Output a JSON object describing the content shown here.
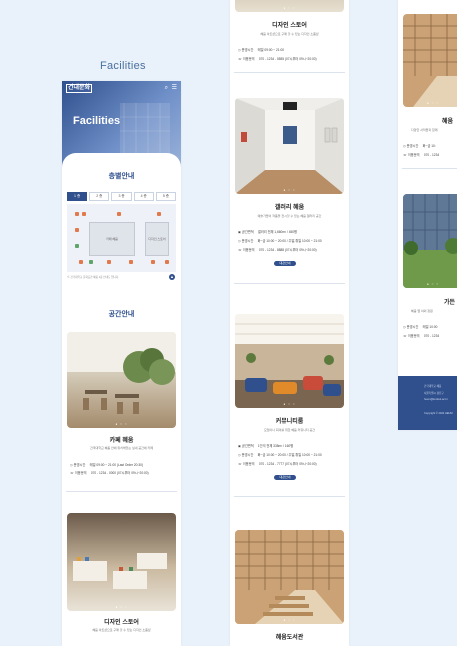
{
  "section_label": "Facilities",
  "mobile": {
    "logo": "건대문화",
    "hero_title": "Facilities",
    "floor_guide": {
      "title": "층별안내",
      "floors": [
        "1 층",
        "2 층",
        "3 층",
        "4 층",
        "5 층"
      ],
      "rooms": [
        "카페 혜움",
        "디자인 스토어"
      ],
      "note": "※ 건국대학교 문화공간 혜움 1층 안내도 입니다."
    },
    "space_guide_title": "공간안내",
    "cafe": {
      "title": "카페 혜움",
      "desc": "건국대학교 혜움 안에 위치해있는 실내 공간에 카페",
      "hours_label": "운영시간",
      "hours": "매일 09:00 ~ 21:00 (Last Order 20:30)",
      "phone_label": "이용문의",
      "phone": "070 - 1234 - 0000 (07시부터 09시~20:00)"
    },
    "store_left": {
      "title": "디자인 스토어",
      "desc": "혜움 아트샵으로 구매 할 수 있는 디자인 소품샵"
    }
  },
  "column2": {
    "store": {
      "title": "디자인 스토어",
      "desc": "혜움 아트샵으로 구매 할 수 있는 디자인 소품샵",
      "hours_label": "운영시간",
      "hours": "매일 09:00 ~ 21:00",
      "phone_label": "이용문의",
      "phone": "070 - 1234 - 5555 (07시부터 09시~20:00)"
    },
    "gallery": {
      "title": "갤러리 혜움",
      "desc": "예술가들이 작품을 전시할 수 있는 혜움 갤러리 공간",
      "area_label": "공간면적",
      "area": "갤러리 전체 1,660m² / 450평",
      "hours_label": "운영시간",
      "hours": "화~금 10:00 ~ 20:00 / 주말,휴일 10:00 ~ 21:00",
      "phone_label": "이용문의",
      "phone": "070 - 1234 - 8888 (07시부터 09시~20:00)",
      "button": "대관안내"
    },
    "community": {
      "title": "커뮤니티룸",
      "desc": "모임이나 회의를 위한 혜움 커뮤니티 공간",
      "area_label": "공간면적",
      "area": "1인석 전체 335m² / 160평",
      "hours_label": "운영시간",
      "hours": "화~금 10:00 ~ 20:00 / 주말,휴일 10:00 ~ 21:00",
      "phone_label": "이용문의",
      "phone": "070 - 1234 - 7777 (07시부터 09시~20:00)",
      "button": "대관안내"
    },
    "library": {
      "title": "혜움도서관"
    }
  },
  "column3": {
    "library": {
      "title": "혜움",
      "desc": "다양한 서적들과 함께",
      "hours_label": "운영시간",
      "hours": "화~금 10:",
      "phone_label": "이용문의",
      "phone": "070 - 1234"
    },
    "garden": {
      "title": "가든",
      "desc": "혜움 옆 야외 정원",
      "hours_label": "운영시간",
      "hours": "매일 10:00",
      "phone_label": "이용문의",
      "phone": "070 - 1234"
    },
    "footer": {
      "line1": "건국대학교 혜움",
      "line2": "서울특별시 광진구",
      "line3": "heum@konkuk.ac.kr",
      "copyright": "Copyright © 2024 HEUM"
    }
  },
  "colors": {
    "brand": "#2f4f8d",
    "page_bg": "#e9f1fa"
  },
  "icons": [
    "search-icon",
    "menu-icon",
    "clock-icon",
    "phone-icon",
    "area-icon",
    "top-arrow-icon"
  ]
}
